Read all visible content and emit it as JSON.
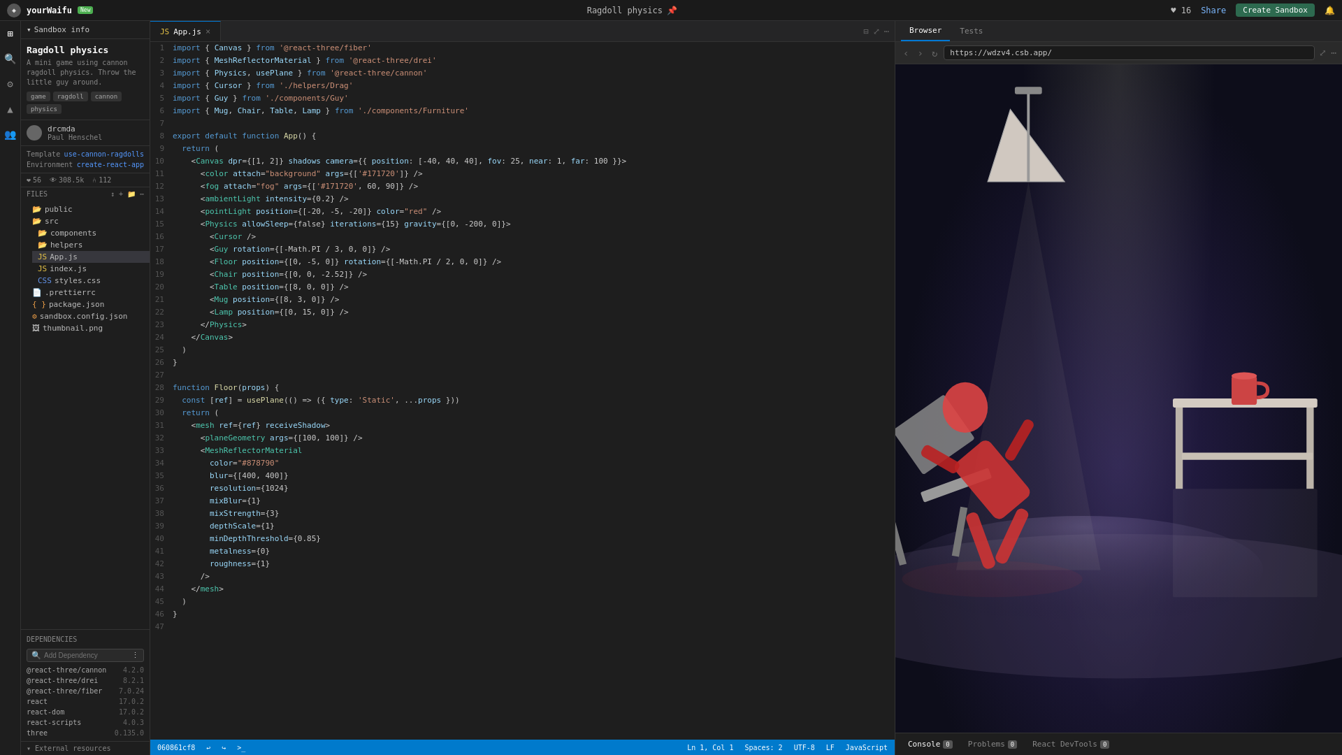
{
  "app": {
    "brand": "yourWaifu",
    "tag": "New",
    "title": "Ragdoll physics",
    "pin_icon": "📌",
    "topbar_center_title": "Ragdoll physics",
    "likes": "16",
    "share_label": "Share",
    "create_sandbox_label": "Create Sandbox"
  },
  "sandbox_info": {
    "section_label": "Sandbox info",
    "title": "Ragdoll physics",
    "description": "A mini game using cannon ragdoll physics. Throw the little guy around.",
    "tags": [
      "game",
      "ragdoll",
      "cannon",
      "physics"
    ],
    "author_name": "drcmda",
    "author_handle": "Paul Henschel",
    "template_label": "Template",
    "template_value": "use-cannon-ragdolls",
    "environment_label": "Environment",
    "environment_value": "create-react-app",
    "likes_label": "❤",
    "likes_count": "56",
    "views_count": "308.5k",
    "forks_count": "112"
  },
  "files": {
    "section_label": "Files",
    "items": [
      {
        "name": "public",
        "type": "folder",
        "indent": 1
      },
      {
        "name": "src",
        "type": "folder",
        "indent": 1
      },
      {
        "name": "components",
        "type": "folder",
        "indent": 2
      },
      {
        "name": "helpers",
        "type": "folder",
        "indent": 2
      },
      {
        "name": "App.js",
        "type": "file-js",
        "indent": 2,
        "active": true
      },
      {
        "name": "index.js",
        "type": "file-js",
        "indent": 2
      },
      {
        "name": "styles.css",
        "type": "file-css",
        "indent": 2
      },
      {
        "name": ".prettierrc",
        "type": "file",
        "indent": 1
      },
      {
        "name": "package.json",
        "type": "file-json",
        "indent": 1
      },
      {
        "name": "sandbox.config.json",
        "type": "file-json",
        "indent": 1
      },
      {
        "name": "thumbnail.png",
        "type": "file-img",
        "indent": 1
      }
    ]
  },
  "dependencies": {
    "section_label": "Dependencies",
    "search_placeholder": "Add Dependency",
    "items": [
      {
        "name": "@react-three/cannon",
        "version": "4.2.0"
      },
      {
        "name": "@react-three/drei",
        "version": "8.2.1"
      },
      {
        "name": "@react-three/fiber",
        "version": "7.0.24"
      },
      {
        "name": "react",
        "version": "17.0.2"
      },
      {
        "name": "react-dom",
        "version": "17.0.2"
      },
      {
        "name": "react-scripts",
        "version": "4.0.3"
      },
      {
        "name": "three",
        "version": "0.135.0"
      }
    ]
  },
  "external_resources": {
    "label": "External resources"
  },
  "editor": {
    "tab_label": "App.js",
    "code_lines": [
      {
        "n": 1,
        "text": "import { Canvas } from '@react-three/fiber'"
      },
      {
        "n": 2,
        "text": "import { MeshReflectorMaterial } from '@react-three/drei'"
      },
      {
        "n": 3,
        "text": "import { Physics, usePlane } from '@react-three/cannon'"
      },
      {
        "n": 4,
        "text": "import { Cursor } from './helpers/Drag'"
      },
      {
        "n": 5,
        "text": "import { Guy } from './components/Guy'"
      },
      {
        "n": 6,
        "text": "import { Mug, Chair, Table, Lamp } from './components/Furniture'"
      },
      {
        "n": 7,
        "text": ""
      },
      {
        "n": 8,
        "text": "export default function App() {"
      },
      {
        "n": 9,
        "text": "  return ("
      },
      {
        "n": 10,
        "text": "    <Canvas dpr={[1, 2]} shadows camera={{ position: [-40, 40, 40], fov: 25, near: 1, far: 100 }}>"
      },
      {
        "n": 11,
        "text": "      <color attach=\"background\" args={['#171720']} />"
      },
      {
        "n": 12,
        "text": "      <fog attach=\"fog\" args={['#171720', 60, 90]} />"
      },
      {
        "n": 13,
        "text": "      <ambientLight intensity={0.2} />"
      },
      {
        "n": 14,
        "text": "      <pointLight position={[-20, -5, -20]} color=\"red\" />"
      },
      {
        "n": 15,
        "text": "      <Physics allowSleep={false} iterations={15} gravity={[0, -200, 0]}>"
      },
      {
        "n": 16,
        "text": "        <Cursor />"
      },
      {
        "n": 17,
        "text": "        <Guy rotation={[-Math.PI / 3, 0, 0]} />"
      },
      {
        "n": 18,
        "text": "        <Floor position={[0, -5, 0]} rotation={[-Math.PI / 2, 0, 0]} />"
      },
      {
        "n": 19,
        "text": "        <Chair position={[0, 0, -2.52]} />"
      },
      {
        "n": 20,
        "text": "        <Table position={[8, 0, 0]} />"
      },
      {
        "n": 21,
        "text": "        <Mug position={[8, 3, 0]} />"
      },
      {
        "n": 22,
        "text": "        <Lamp position={[0, 15, 0]} />"
      },
      {
        "n": 23,
        "text": "      </Physics>"
      },
      {
        "n": 24,
        "text": "    </Canvas>"
      },
      {
        "n": 25,
        "text": "  )"
      },
      {
        "n": 26,
        "text": "}"
      },
      {
        "n": 27,
        "text": ""
      },
      {
        "n": 28,
        "text": "function Floor(props) {"
      },
      {
        "n": 29,
        "text": "  const [ref] = usePlane(() => ({ type: 'Static', ...props }))"
      },
      {
        "n": 30,
        "text": "  return ("
      },
      {
        "n": 31,
        "text": "    <mesh ref={ref} receiveShadow>"
      },
      {
        "n": 32,
        "text": "      <planeGeometry args={[100, 100]} />"
      },
      {
        "n": 33,
        "text": "      <MeshReflectorMaterial"
      },
      {
        "n": 34,
        "text": "        color=\"#878790\""
      },
      {
        "n": 35,
        "text": "        blur={[400, 400]}"
      },
      {
        "n": 36,
        "text": "        resolution={1024}"
      },
      {
        "n": 37,
        "text": "        mixBlur={1}"
      },
      {
        "n": 38,
        "text": "        mixStrength={3}"
      },
      {
        "n": 39,
        "text": "        depthScale={1}"
      },
      {
        "n": 40,
        "text": "        minDepthThreshold={0.85}"
      },
      {
        "n": 41,
        "text": "        metalness={0}"
      },
      {
        "n": 42,
        "text": "        roughness={1}"
      },
      {
        "n": 43,
        "text": "      />"
      },
      {
        "n": 44,
        "text": "    </mesh>"
      },
      {
        "n": 45,
        "text": "  )"
      },
      {
        "n": 46,
        "text": "}"
      },
      {
        "n": 47,
        "text": ""
      }
    ]
  },
  "browser": {
    "tab_browser": "Browser",
    "tab_tests": "Tests",
    "url": "https://wdzv4.csb.app/",
    "back_btn": "‹",
    "forward_btn": "›",
    "refresh_btn": "↻"
  },
  "console": {
    "tab_console": "Console",
    "tab_problems": "Problems",
    "tab_react_devtools": "React DevTools",
    "console_badge": "0",
    "problems_badge": "0",
    "react_devtools_badge": "0"
  },
  "status_bar": {
    "hash": "060861cf8",
    "undo": "↩",
    "redo": "↪",
    "terminal": ">_",
    "ln_col": "Ln 1, Col 1",
    "spaces": "Spaces: 2",
    "encoding": "UTF-8",
    "eol": "LF",
    "language": "JavaScript"
  }
}
